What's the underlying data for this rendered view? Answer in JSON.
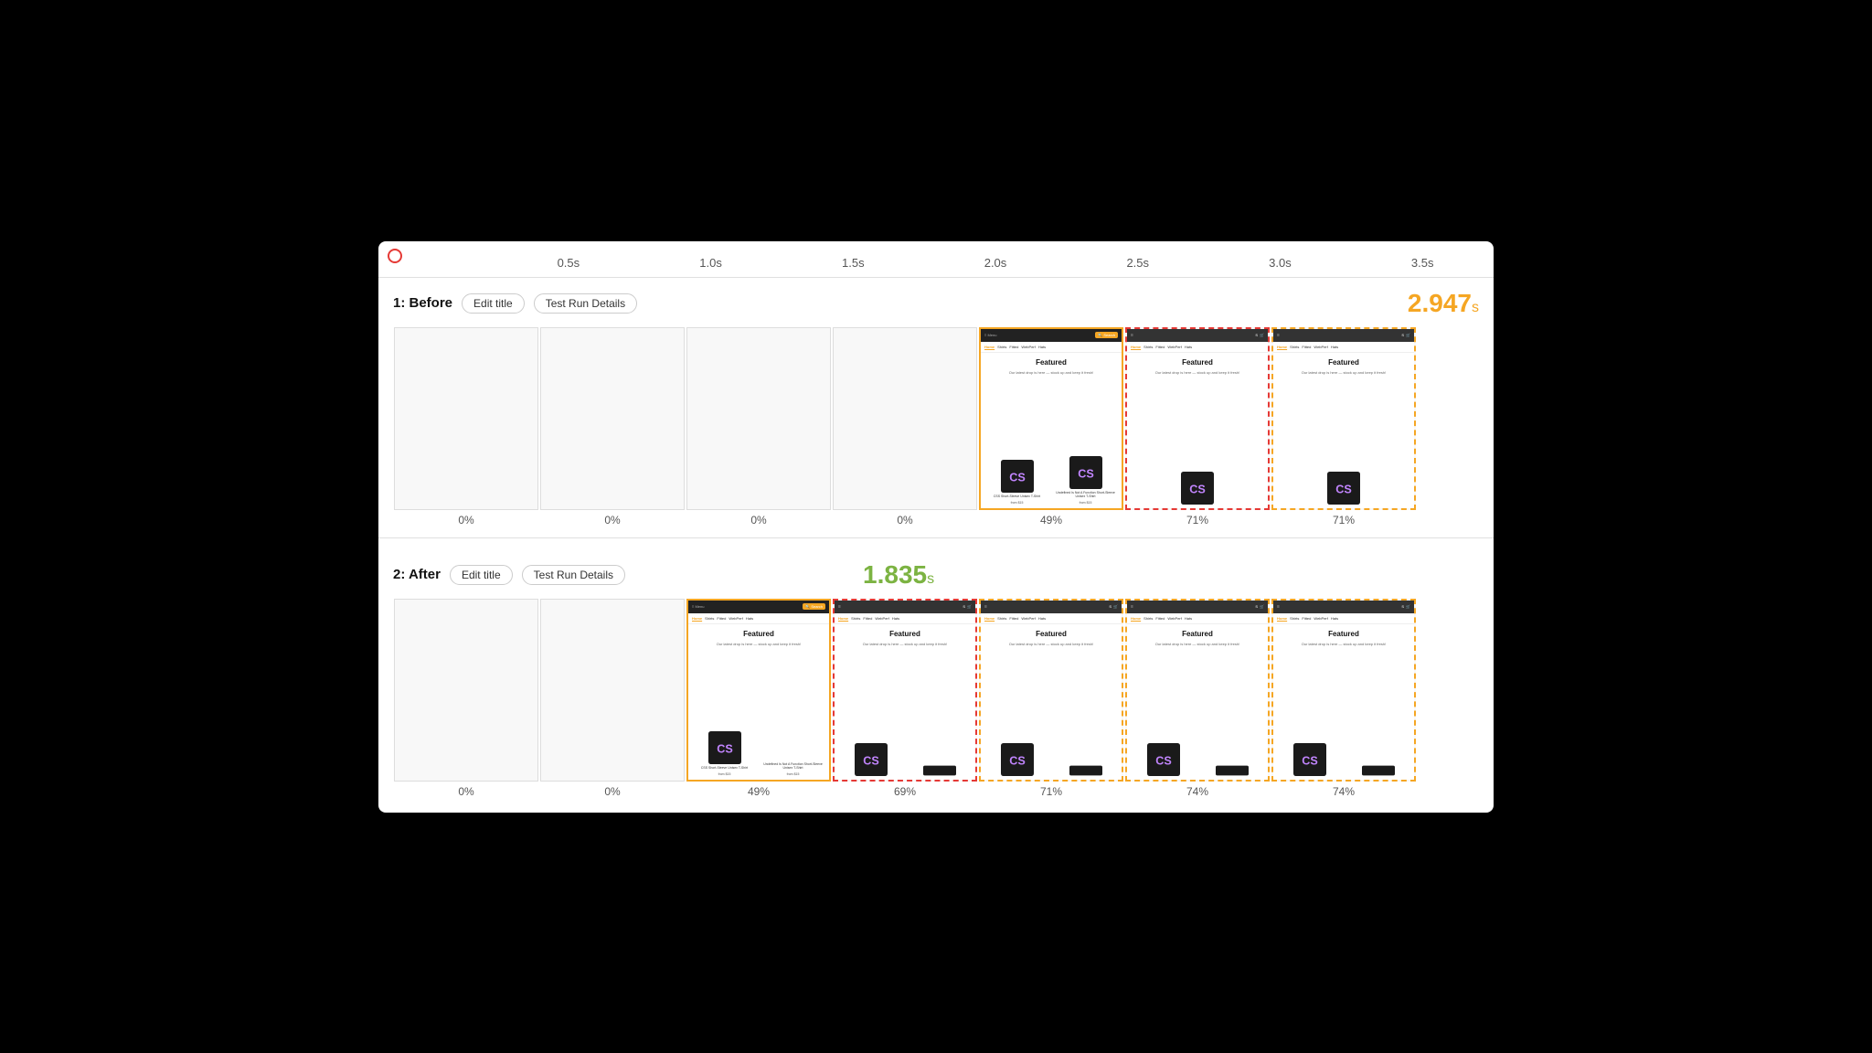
{
  "timeline": {
    "ticks": [
      "0.5s",
      "1.0s",
      "1.5s",
      "2.0s",
      "2.5s",
      "3.0s",
      "3.5s"
    ]
  },
  "before": {
    "label": "1: Before",
    "edit_title": "Edit title",
    "test_run": "Test Run Details",
    "metric": "2.947",
    "metric_unit": "s",
    "frames": [
      {
        "pct": "0%",
        "type": "empty"
      },
      {
        "pct": "0%",
        "type": "empty"
      },
      {
        "pct": "0%",
        "type": "empty"
      },
      {
        "pct": "0%",
        "type": "empty"
      },
      {
        "pct": "49%",
        "type": "browser",
        "highlight": "orange"
      },
      {
        "pct": "71%",
        "type": "browser",
        "highlight": "red-dashed"
      },
      {
        "pct": "71%",
        "type": "browser",
        "highlight": "yellow-dashed"
      }
    ]
  },
  "after": {
    "label": "2: After",
    "edit_title": "Edit title",
    "test_run": "Test Run Details",
    "metric": "1.835",
    "metric_unit": "s",
    "frames": [
      {
        "pct": "0%",
        "type": "empty"
      },
      {
        "pct": "0%",
        "type": "empty"
      },
      {
        "pct": "49%",
        "type": "browser",
        "highlight": "orange"
      },
      {
        "pct": "69%",
        "type": "browser",
        "highlight": "red-dashed"
      },
      {
        "pct": "71%",
        "type": "browser",
        "highlight": "orange-dashed"
      },
      {
        "pct": "74%",
        "type": "browser",
        "highlight": "orange-dashed"
      },
      {
        "pct": "74%",
        "type": "browser",
        "highlight": "yellow-dashed"
      }
    ]
  },
  "nav_items": [
    "Home",
    "Shirts",
    "Fitted",
    "WebPerf",
    "Hats"
  ],
  "featured_text": "Featured",
  "featured_desc": "Our latest drop is here — stock up and keep it fresh!",
  "product1_name": "CSS Short-Sleeve Unisex T-Shirt",
  "product1_price": "from $15",
  "product2_name": "Undefined Is Not A Function Short-Sleeve Unisex T-Shirt",
  "product2_price": "from $15"
}
